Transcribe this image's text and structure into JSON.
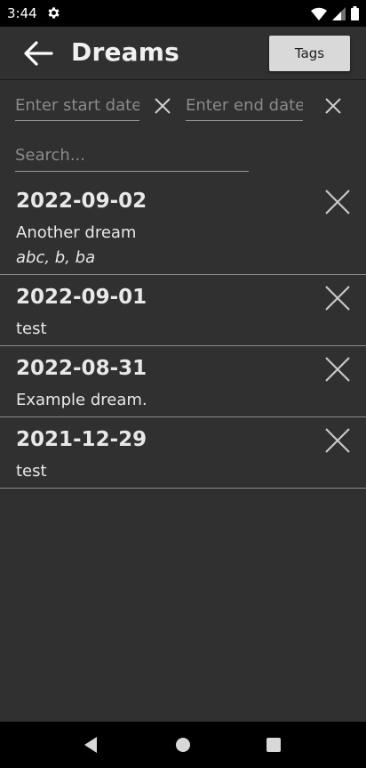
{
  "status_bar": {
    "time": "3:44",
    "icons": [
      "gear-icon",
      "wifi-icon",
      "signal-icon",
      "battery-icon"
    ]
  },
  "header": {
    "title": "Dreams",
    "tags_label": "Tags"
  },
  "filters": {
    "start_date_placeholder": "Enter start date",
    "end_date_placeholder": "Enter end date",
    "search_placeholder": "Search..."
  },
  "dreams": [
    {
      "date": "2022-09-02",
      "text": "Another dream",
      "tags": "abc, b, ba"
    },
    {
      "date": "2022-09-01",
      "text": "test",
      "tags": ""
    },
    {
      "date": "2022-08-31",
      "text": "Example dream.",
      "tags": ""
    },
    {
      "date": "2021-12-29",
      "text": "test",
      "tags": ""
    }
  ],
  "colors": {
    "background": "#303030",
    "status_bar": "#000000",
    "button_bg": "#d9d9d9",
    "text": "#e8e8e8",
    "placeholder": "#8a8a8a",
    "divider": "#8a8a8a"
  }
}
